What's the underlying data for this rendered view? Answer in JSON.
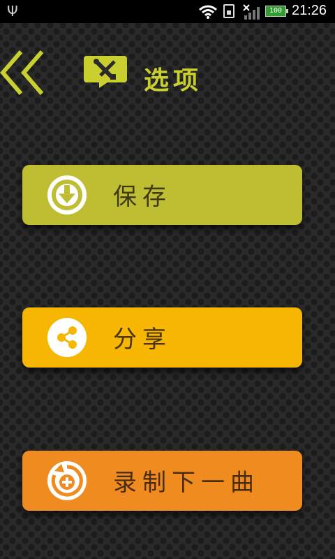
{
  "status_bar": {
    "time": "21:26",
    "battery": "100",
    "icons": [
      "usb-icon",
      "wifi-icon",
      "sim-icon",
      "signal-icon",
      "battery-icon"
    ]
  },
  "header": {
    "title": "选项",
    "back_icon": "double-chevron-left-icon",
    "options_icon": "tools-icon"
  },
  "buttons": {
    "save": {
      "label": "保存",
      "icon": "download-icon",
      "color": "#bfbe33"
    },
    "share": {
      "label": "分享",
      "icon": "share-icon",
      "color": "#f6b601"
    },
    "record_next": {
      "label": "录制下一曲",
      "icon": "replay-add-icon",
      "color": "#f08b1f"
    }
  },
  "colors": {
    "accent": "#c8cf2f",
    "status_bar": "#000000",
    "background": "#2a2a2a"
  }
}
